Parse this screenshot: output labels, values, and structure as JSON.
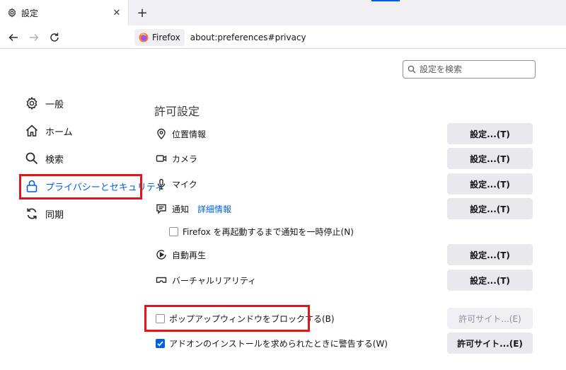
{
  "tab": {
    "title": "設定"
  },
  "urlbar": {
    "identity": "Firefox",
    "url": "about:preferences#privacy"
  },
  "search": {
    "placeholder": "設定を検索"
  },
  "sidebar": {
    "items": [
      {
        "label": "一般",
        "icon": "gear-icon"
      },
      {
        "label": "ホーム",
        "icon": "home-icon"
      },
      {
        "label": "検索",
        "icon": "search-icon"
      },
      {
        "label": "プライバシーとセキュリティ",
        "icon": "lock-icon",
        "selected": true
      },
      {
        "label": "同期",
        "icon": "sync-icon"
      }
    ]
  },
  "permissions": {
    "title": "許可設定",
    "rows": [
      {
        "label": "位置情報",
        "icon": "location-icon",
        "button": "設定...(T)"
      },
      {
        "label": "カメラ",
        "icon": "camera-icon",
        "button": "設定...(T)"
      },
      {
        "label": "マイク",
        "icon": "microphone-icon",
        "button": "設定...(T)"
      },
      {
        "label": "通知",
        "icon": "notification-icon",
        "button": "設定...(T)",
        "link": "詳細情報"
      },
      {
        "label": "自動再生",
        "icon": "autoplay-icon",
        "button": "設定...(T)"
      },
      {
        "label": "バーチャルリアリティ",
        "icon": "vr-icon",
        "button": "設定...(T)"
      }
    ],
    "pause_notifications": {
      "label": "Firefox を再起動するまで通知を一時停止(N)",
      "checked": false
    },
    "block_popups": {
      "label": "ポップアップウィンドウをブロックする(B)",
      "checked": false,
      "button": "許可サイト...(E)"
    },
    "warn_addons": {
      "label": "アドオンのインストールを求められたときに警告する(W)",
      "checked": true,
      "button": "許可サイト...(E)"
    }
  },
  "colors": {
    "accent": "#0060df",
    "highlight_box": "#e3151c"
  }
}
